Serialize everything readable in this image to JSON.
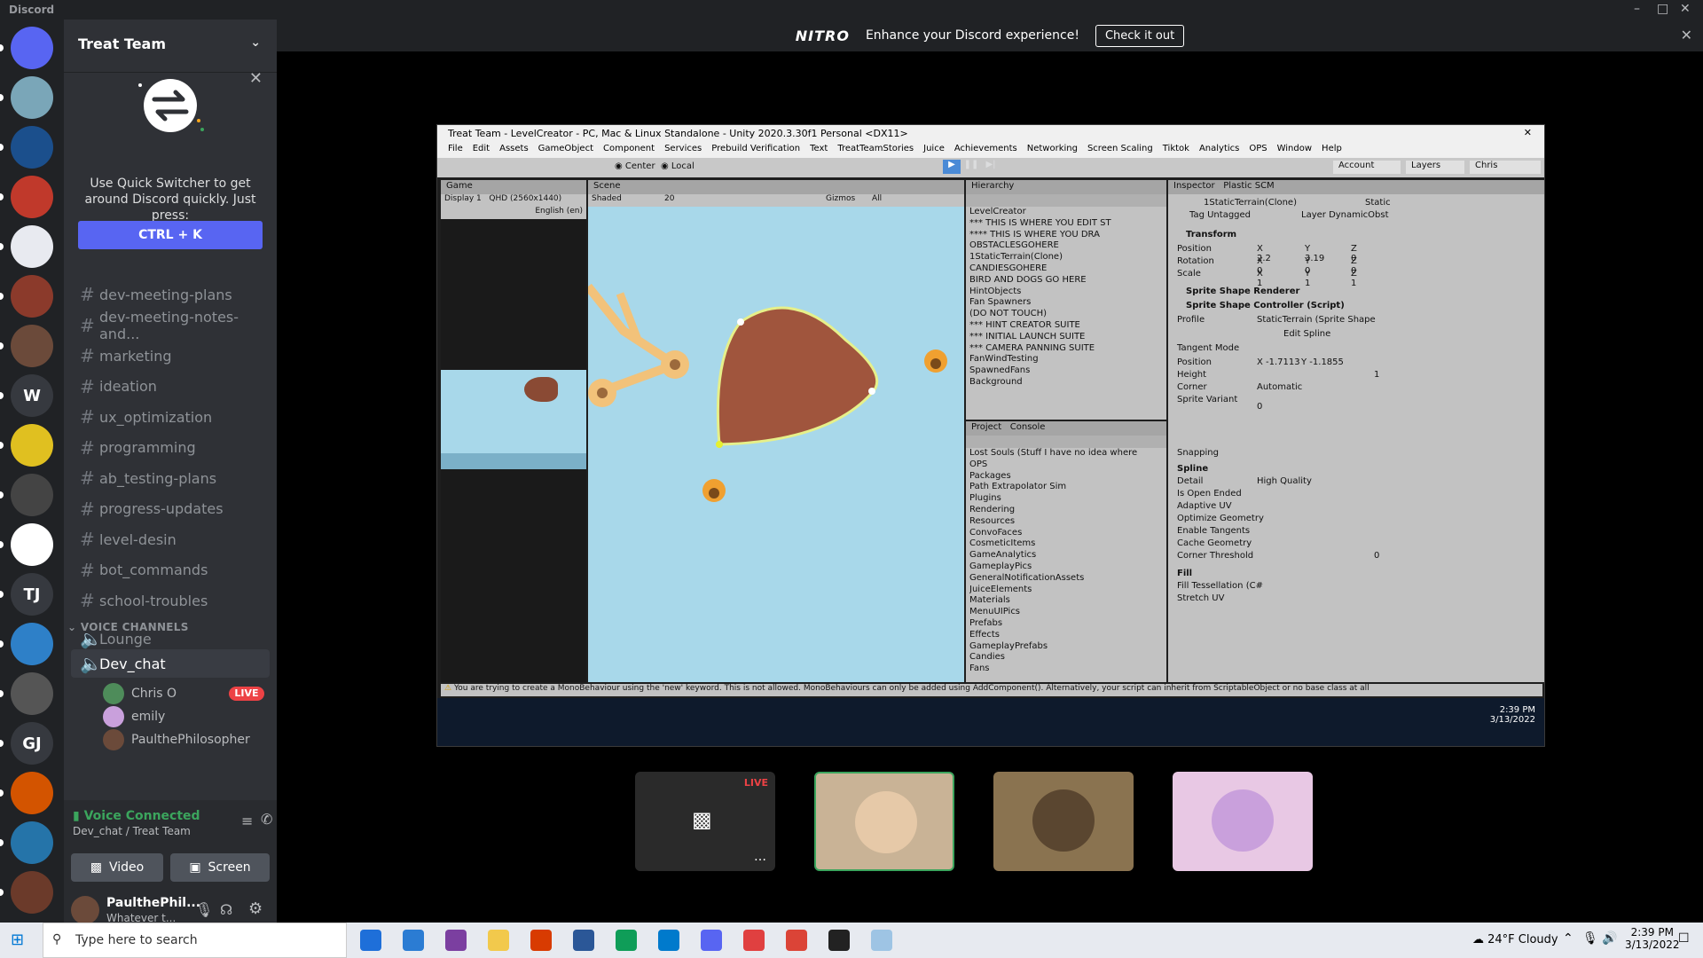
{
  "window": {
    "app_name": "Discord"
  },
  "nitro": {
    "logo": "NITRO",
    "message": "Enhance your Discord experience!",
    "button": "Check it out"
  },
  "servers": [
    {
      "label": "",
      "color": "#5865f2",
      "icon": "discord-home-icon"
    },
    {
      "label": "",
      "color": "#7aa6b8",
      "icon": "server-avatar"
    },
    {
      "label": "",
      "color": "#1b4f8c",
      "icon": "server-avatar"
    },
    {
      "label": "",
      "color": "#c0392b",
      "icon": "server-avatar"
    },
    {
      "label": "",
      "color": "#e8eaf0",
      "icon": "server-avatar"
    },
    {
      "label": "",
      "color": "#8b3a2b",
      "icon": "server-avatar"
    },
    {
      "label": "",
      "color": "#6b4a3a",
      "icon": "server-avatar"
    },
    {
      "label": "W",
      "color": "#36393f",
      "icon": ""
    },
    {
      "label": "",
      "color": "#e0c020",
      "icon": "server-avatar"
    },
    {
      "label": "",
      "color": "#444444",
      "icon": "server-avatar"
    },
    {
      "label": "",
      "color": "#ffffff",
      "icon": "server-avatar"
    },
    {
      "label": "TJ",
      "color": "#36393f",
      "icon": ""
    },
    {
      "label": "",
      "color": "#2e80c8",
      "icon": "server-avatar"
    },
    {
      "label": "",
      "color": "#555555",
      "icon": "server-avatar"
    },
    {
      "label": "GJ",
      "color": "#36393f",
      "icon": ""
    },
    {
      "label": "",
      "color": "#d35400",
      "icon": "server-avatar"
    },
    {
      "label": "",
      "color": "#2574a9",
      "icon": "server-avatar"
    },
    {
      "label": "",
      "color": "#6b3a2a",
      "icon": "server-avatar"
    }
  ],
  "guild": {
    "name": "Treat Team"
  },
  "quick_switcher": {
    "text": "Use Quick Switcher to get around Discord quickly. Just press:",
    "shortcut": "CTRL + K"
  },
  "channels": [
    "dev-meeting-plans",
    "dev-meeting-notes-and...",
    "marketing",
    "ideation",
    "ux_optimization",
    "programming",
    "ab_testing-plans",
    "progress-updates",
    "level-desin",
    "bot_commands",
    "school-troubles"
  ],
  "voice": {
    "header": "VOICE CHANNELS",
    "channels": [
      "Lounge",
      "Dev_chat"
    ],
    "users": [
      {
        "name": "Chris O",
        "live": "LIVE",
        "color": "#4e8c5a"
      },
      {
        "name": "emily",
        "live": "",
        "color": "#c9a0dc"
      },
      {
        "name": "PaulthePhilosopher",
        "live": "",
        "color": "#6b4a3a"
      }
    ]
  },
  "panel": {
    "status": "Voice Connected",
    "location": "Dev_chat / Treat Team",
    "video": "Video",
    "screen": "Screen",
    "username": "PaulthePhil...",
    "user_status": "Whatever t..."
  },
  "unity": {
    "title": "Treat Team - LevelCreator - PC, Mac & Linux Standalone - Unity 2020.3.30f1 Personal <DX11>",
    "menu": [
      "File",
      "Edit",
      "Assets",
      "GameObject",
      "Component",
      "Services",
      "Prebuild Verification",
      "Text",
      "TreatTeamStories",
      "Juice",
      "Achievements",
      "Networking",
      "Screen Scaling",
      "Tiktok",
      "Analytics",
      "OPS",
      "Window",
      "Help"
    ],
    "toolbar": {
      "center": "Center",
      "local": "Local",
      "account": "Account",
      "layers": "Layers",
      "layout": "Chris"
    },
    "game_tab": "Game",
    "display": "Display 1",
    "resolution": "QHD (2560x1440)",
    "language": "English (en)",
    "scene_tab": "Scene",
    "shading": "Shaded",
    "gizmos": "Gizmos",
    "all": "All",
    "count": "20",
    "hierarchy_tab": "Hierarchy",
    "hierarchy": [
      "LevelCreator",
      "*** THIS IS WHERE YOU EDIT ST",
      "**** THIS IS WHERE YOU DRA",
      "OBSTACLESGOHERE",
      "1StaticTerrain(Clone)",
      "CANDIESGOHERE",
      "BIRD AND DOGS GO HERE",
      "HintObjects",
      "Fan Spawners",
      "(DO NOT TOUCH)",
      "*** HINT CREATOR SUITE",
      "*** INITIAL LAUNCH SUITE",
      "*** CAMERA PANNING SUITE",
      "FanWindTesting",
      "SpawnedFans",
      "Background"
    ],
    "project_tab": "Project",
    "console_tab": "Console",
    "project": [
      "Lost Souls (Stuff I have no idea where",
      "OPS",
      "Packages",
      "Path Extrapolator Sim",
      "Plugins",
      "Rendering",
      "Resources",
      "ConvoFaces",
      "CosmeticItems",
      "GameAnalytics",
      "GameplayPics",
      "GeneralNotificationAssets",
      "JuiceElements",
      "Materials",
      "MenuUIPics",
      "Prefabs",
      "Effects",
      "GameplayPrefabs",
      "Candies",
      "Fans"
    ],
    "inspector_tab": "Inspector",
    "plastic_tab": "Plastic SCM",
    "object_name": "1StaticTerrain(Clone)",
    "static": "Static",
    "tag": "Untagged",
    "layer": "DynamicObst",
    "transform": "Transform",
    "position": {
      "x": "2.2",
      "y": "3.19",
      "z": "0"
    },
    "rotation": {
      "x": "0",
      "y": "0",
      "z": "0"
    },
    "scale": {
      "x": "1",
      "y": "1",
      "z": "1"
    },
    "components": [
      "Sprite Shape Renderer",
      "Sprite Shape Controller (Script)"
    ],
    "profile": "StaticTerrain (Sprite Shape",
    "edit_spline": "Edit Spline",
    "tangent_mode": "Tangent Mode",
    "point_pos": {
      "x": "-1.7113",
      "y": "-1.1855"
    },
    "height": "1",
    "corner": "Automatic",
    "labels": [
      "Profile",
      "Position",
      "Height",
      "Corner",
      "Sprite Variant",
      "Snapping",
      "Spline",
      "Detail",
      "Is Open Ended",
      "Adaptive UV",
      "Optimize Geometry",
      "Enable Tangents",
      "Cache Geometry",
      "Corner Threshold",
      "Fill",
      "Fill Tessellation (C#",
      "Stretch UV"
    ],
    "detail": "High Quality",
    "corner_threshold": "0",
    "sprite_variant": "0",
    "warning": "You are trying to create a MonoBehaviour using the 'new' keyword.  This is not allowed.  MonoBehaviours can only be added using AddComponent(). Alternatively, your script can inherit from ScriptableObject or no base class at all",
    "clock_time": "2:39 PM",
    "clock_date": "3/13/2022"
  },
  "tiles": {
    "live": "LIVE"
  },
  "taskbar": {
    "search": "Type here to search",
    "weather": "24°F  Cloudy",
    "time": "2:39 PM",
    "date": "3/13/2022"
  }
}
